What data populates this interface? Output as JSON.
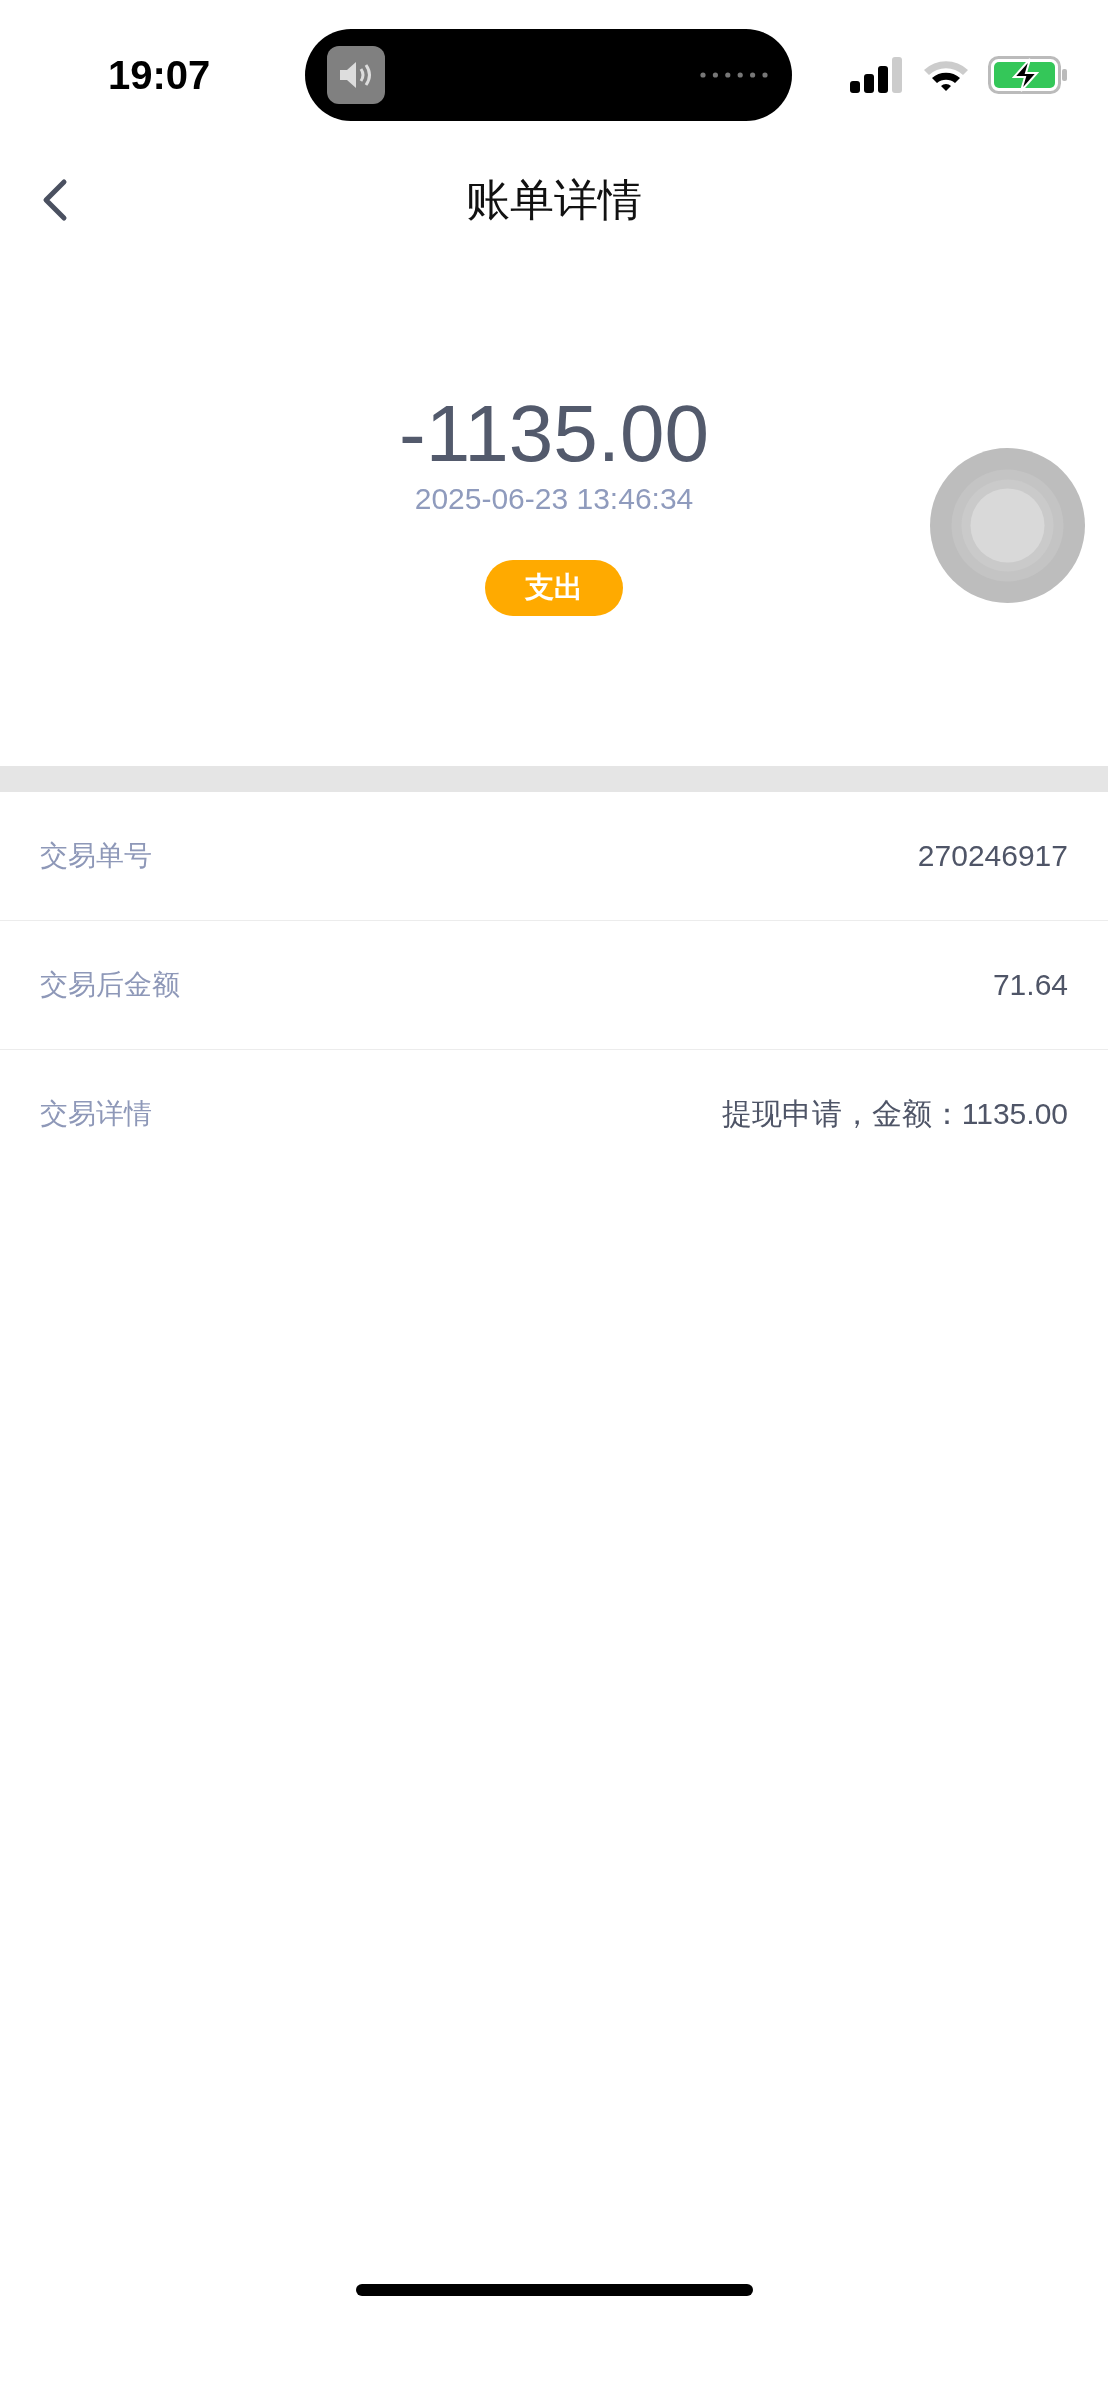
{
  "status_bar": {
    "time": "19:07"
  },
  "header": {
    "title": "账单详情"
  },
  "summary": {
    "amount": "-1135.00",
    "datetime": "2025-06-23 13:46:34",
    "type": "支出"
  },
  "details": [
    {
      "label": "交易单号",
      "value": "270246917"
    },
    {
      "label": "交易后金额",
      "value": "71.64"
    },
    {
      "label": "交易详情",
      "value": "提现申请，金额：1135.00"
    }
  ]
}
